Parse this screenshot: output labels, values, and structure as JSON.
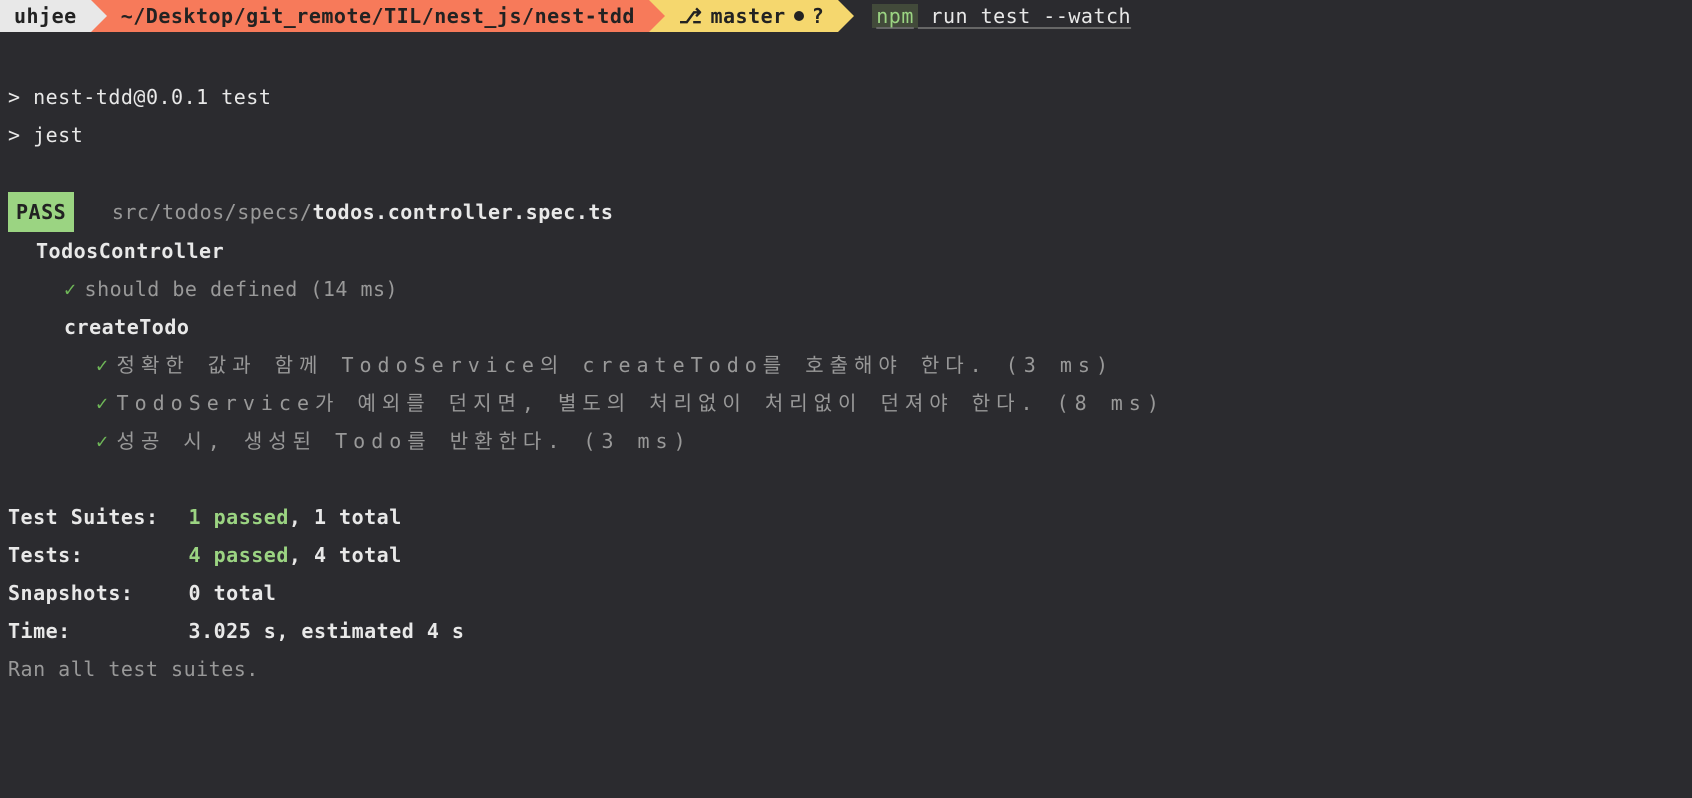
{
  "prompt": {
    "user": "uhjee",
    "path": "~/Desktop/git_remote/TIL/nest_js/nest-tdd",
    "branch_icon": "⎇",
    "branch": "master",
    "branch_status": "?",
    "cmd_npm": "npm",
    "cmd_rest": " run test --watch"
  },
  "run": {
    "line1": "> nest-tdd@0.0.1 test",
    "line2": "> jest"
  },
  "pass_badge": "PASS",
  "file": {
    "dir": "src/todos/specs/",
    "name": "todos.controller.spec.ts"
  },
  "suites": {
    "root": "TodosController",
    "t1": "should be defined (14 ms)",
    "inner": "createTodo",
    "t2": "정확한 값과 함께 TodoService의 createTodo를 호출해야 한다. (3 ms)",
    "t3": "TodoService가 예외를 던지면, 별도의 처리없이 처리없이 던져야 한다. (8 ms)",
    "t4": "성공 시, 생성된 Todo를 반환한다. (3 ms)"
  },
  "summary": {
    "suites_label": "Test Suites:",
    "suites_passed": "1 passed",
    "suites_total": ", 1 total",
    "tests_label": "Tests:",
    "tests_passed": "4 passed",
    "tests_total": ", 4 total",
    "snapshots_label": "Snapshots:",
    "snapshots_val": "0 total",
    "time_label": "Time:",
    "time_val": "3.025 s, estimated 4 s",
    "ran": "Ran all test suites."
  }
}
